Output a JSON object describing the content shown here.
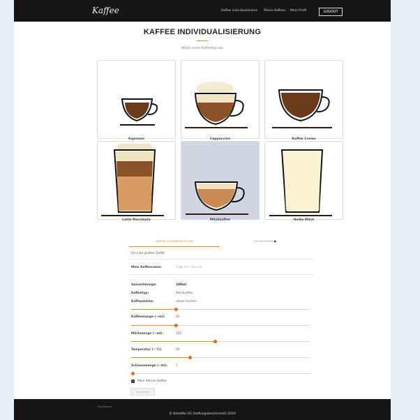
{
  "header": {
    "logo_text": "Kaffee",
    "nav": [
      "Kaffee individualisieren",
      "Meine Kaffees",
      "Mein Profil"
    ],
    "logout_label": "LOGOUT"
  },
  "main": {
    "title": "KAFFEE INDIVIDUALISIERUNG",
    "subtitle": "Wähle einen Kaffeetyp aus"
  },
  "coffees": [
    {
      "name": "Espresso",
      "selected": false,
      "icon": "espresso-cup"
    },
    {
      "name": "Cappuccino",
      "selected": false,
      "icon": "cappuccino-cup"
    },
    {
      "name": "Kaffee Crema",
      "selected": false,
      "icon": "crema-cup"
    },
    {
      "name": "Latte Macchiato",
      "selected": false,
      "icon": "latte-glass"
    },
    {
      "name": "Milchkaffee",
      "selected": true,
      "icon": "milk-coffee-bowl"
    },
    {
      "name": "Heiße Milch",
      "selected": false,
      "icon": "hot-milk-glass"
    }
  ],
  "tabs": {
    "active": "KAFFEE ZUSAMMENSTELLEN",
    "other": "FAVORISIEREN"
  },
  "form": {
    "cup_size_text": "Ein Liter großes Gefäß",
    "name_label": "Mein Kaffeename:",
    "name_placeholder": "Füge hier den ein",
    "summary": [
      {
        "label": "Gesamtmenge:",
        "value": "180ml"
      },
      {
        "label": "Kaffeetyp:",
        "value": "Milchkaffee"
      },
      {
        "label": "Kaffeestärke:",
        "value": "etwas leichter"
      }
    ],
    "sliders": [
      {
        "label": "Kaffeemenge (~ml):",
        "value": "60",
        "fraction": 0.25
      },
      {
        "label": "Milchmenge (~ml):",
        "value": "105",
        "fraction": 0.47
      },
      {
        "label": "Temperatur (~°C):",
        "value": "60",
        "fraction": 0.33
      },
      {
        "label": "Schaummenge (~ml):",
        "value": "7",
        "fraction": 0.0
      }
    ],
    "top_slider_fraction": 0.25,
    "checkbox_label": "Mein Aktiver Kaffee",
    "checkbox_checked": true,
    "save_label": "Speichern"
  },
  "footer": {
    "left": "Impressum",
    "copyright": "© KaHaMo UG (haftungsbeschränkt) 2019"
  },
  "colors": {
    "accent": "#e08a2e",
    "thumb": "#e06a1a",
    "dark": "#151515",
    "coffee": "#6b3a1a"
  }
}
